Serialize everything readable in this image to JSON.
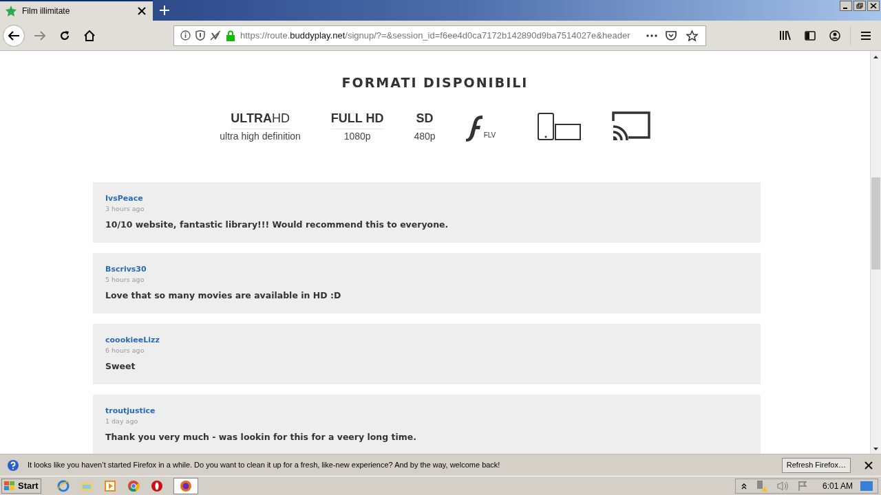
{
  "tab": {
    "title": "Film illimitate",
    "selected": true
  },
  "address": {
    "prefix": "https://route.",
    "domain": "buddyplay.net",
    "suffix": "/signup/?=&session_id=f6ee4d0ca7172b142890d9ba7514027e&header"
  },
  "section_title": "FORMATI DISPONIBILI",
  "formats": [
    {
      "kind": "text",
      "title": "**ULTRA**HD",
      "bold": false,
      "subtitle": "ultra high definition"
    },
    {
      "kind": "text",
      "title": "FULL HD",
      "bold": true,
      "subtitle": "1080p"
    },
    {
      "kind": "text",
      "title": "SD",
      "bold": true,
      "subtitle": "480p"
    },
    {
      "kind": "flash",
      "label": "FLV"
    },
    {
      "kind": "devices"
    },
    {
      "kind": "cast"
    }
  ],
  "comments": [
    {
      "user": "IvsPeace",
      "time": "3 hours ago",
      "text": "10/10 website, fantastic library!!! Would recommend this to everyone."
    },
    {
      "user": "Bscrivs30",
      "time": "5 hours ago",
      "text": "Love that so many movies are available in HD :D"
    },
    {
      "user": "coookieeLizz",
      "time": "6 hours ago",
      "text": "Sweet"
    },
    {
      "user": "troutjustice",
      "time": "1 day ago",
      "text": "Thank you very much - was lookin for this for a veery long time."
    }
  ],
  "notification": {
    "message": "It looks like you haven’t started Firefox in a while. Do you want to clean it up for a fresh, like-new experience? And by the way, welcome back!",
    "button": "Refresh Firefox…"
  },
  "taskbar": {
    "start": "Start",
    "clock": "6:01 AM"
  }
}
